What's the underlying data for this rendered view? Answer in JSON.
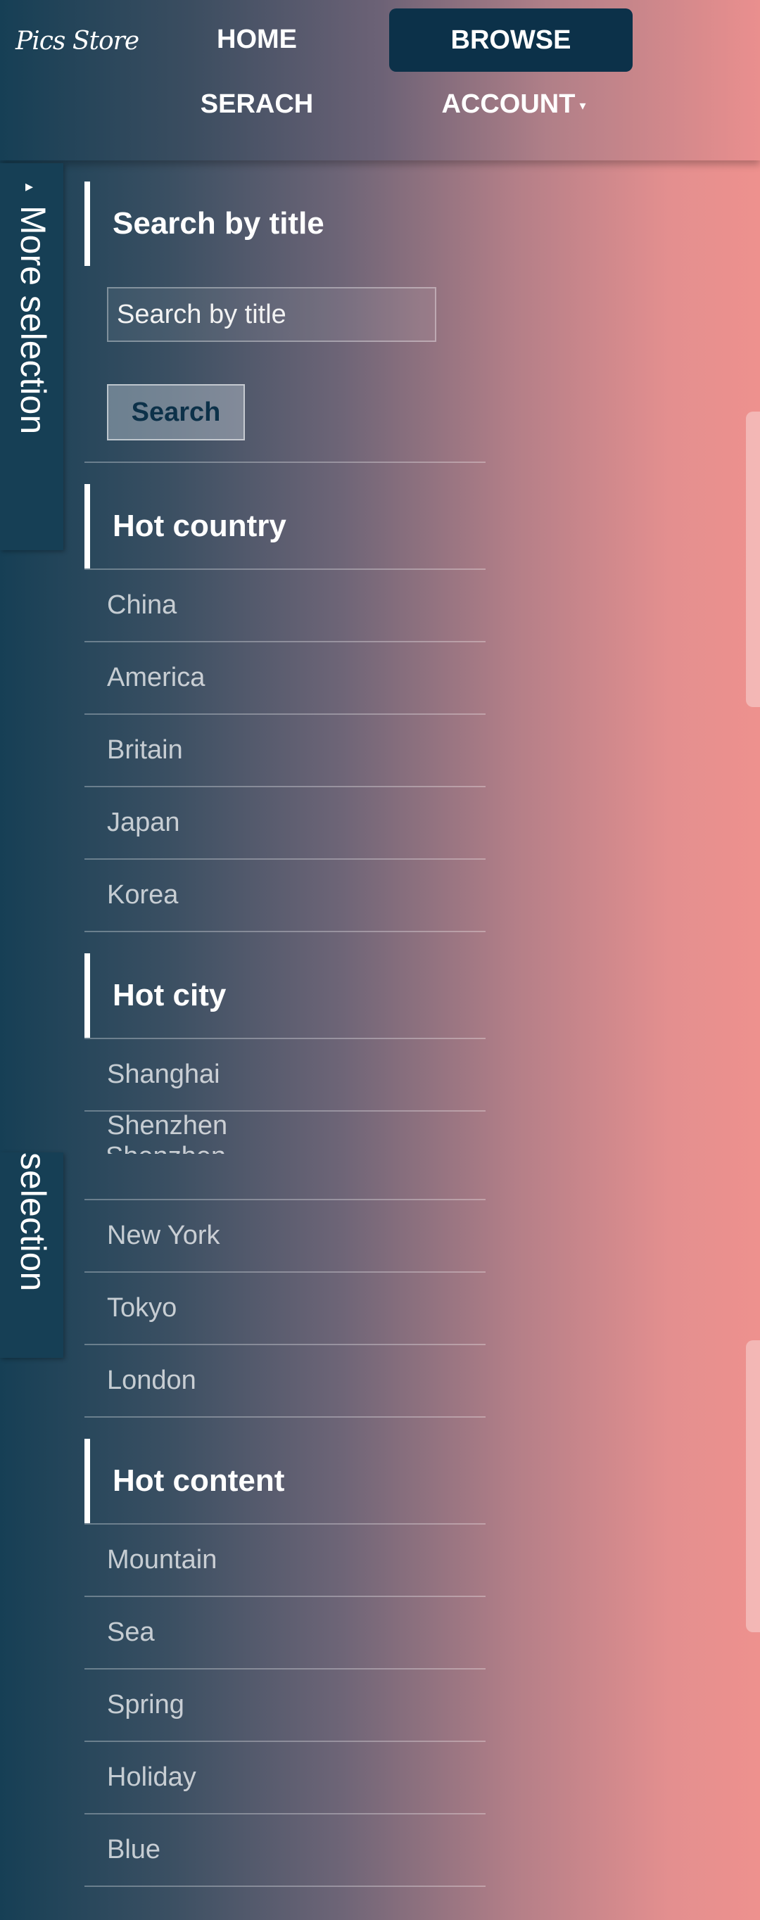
{
  "header": {
    "logo": "Pics Store",
    "nav": {
      "home": "HOME",
      "browse": "BROWSE",
      "search": "SERACH",
      "account": "ACCOUNT",
      "account_caret": "▾"
    }
  },
  "side_tab": {
    "label": "More selection",
    "label_partial": "selection",
    "arrow": "▸"
  },
  "search_section": {
    "title": "Search by title",
    "input_placeholder": "Search by title",
    "button_label": "Search"
  },
  "hot_country": {
    "title": "Hot country",
    "items": [
      "China",
      "America",
      "Britain",
      "Japan",
      "Korea"
    ]
  },
  "hot_city": {
    "title": "Hot city",
    "ghost_item": "Shenzhen",
    "items": [
      "Shanghai",
      "Shenzhen",
      "New York",
      "Tokyo",
      "London"
    ]
  },
  "hot_content": {
    "title": "Hot content",
    "items": [
      "Mountain",
      "Sea",
      "Spring",
      "Holiday",
      "Blue"
    ]
  },
  "colors": {
    "nav_active": "#0c3149",
    "side_tab": "#163f55",
    "gradient_left": "#163f55",
    "gradient_right": "#ee918e"
  }
}
